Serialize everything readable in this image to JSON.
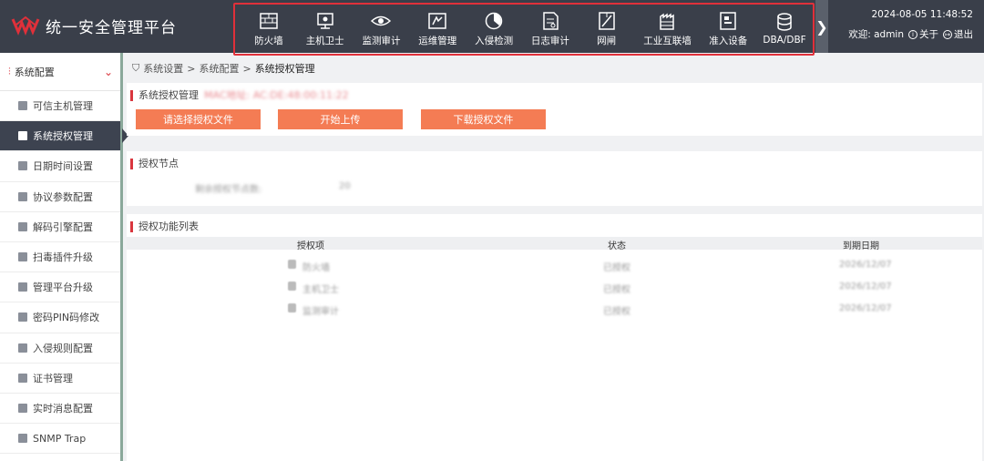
{
  "app": {
    "title": "统一安全管理平台"
  },
  "nav": {
    "items": [
      {
        "label": "防火墙",
        "icon": "firewall-icon"
      },
      {
        "label": "主机卫士",
        "icon": "host-guard-icon"
      },
      {
        "label": "监测审计",
        "icon": "eye-icon"
      },
      {
        "label": "运维管理",
        "icon": "ops-icon"
      },
      {
        "label": "入侵检测",
        "icon": "intrusion-icon"
      },
      {
        "label": "日志审计",
        "icon": "log-icon"
      },
      {
        "label": "网闸",
        "icon": "gateway-icon"
      },
      {
        "label": "工业互联墙",
        "icon": "industrial-icon"
      },
      {
        "label": "准入设备",
        "icon": "access-icon"
      },
      {
        "label": "DBA/DBF",
        "icon": "database-icon"
      }
    ],
    "more": "❯"
  },
  "header": {
    "datetime": "2024-08-05 11:48:52",
    "welcome": "欢迎: admin",
    "about": "关于",
    "logout": "退出"
  },
  "sidebar": {
    "group": "系统配置",
    "items": [
      {
        "label": "可信主机管理"
      },
      {
        "label": "系统授权管理",
        "active": true
      },
      {
        "label": "日期时间设置"
      },
      {
        "label": "协议参数配置"
      },
      {
        "label": "解码引擎配置"
      },
      {
        "label": "扫毒插件升级"
      },
      {
        "label": "管理平台升级"
      },
      {
        "label": "密码PIN码修改"
      },
      {
        "label": "入侵规则配置"
      },
      {
        "label": "证书管理"
      },
      {
        "label": "实时消息配置"
      },
      {
        "label": "SNMP Trap"
      }
    ]
  },
  "breadcrumb": {
    "a": "系统设置",
    "sep": ">",
    "b": "系统配置",
    "c": "系统授权管理"
  },
  "license": {
    "title": "系统授权管理",
    "note": "MAC地址: AC:DE:48:00:11:22",
    "btn_select": "请选择授权文件",
    "btn_upload": "开始上传",
    "btn_download": "下载授权文件"
  },
  "node": {
    "title": "授权节点",
    "label": "剩余授权节点数:",
    "value": "20"
  },
  "features": {
    "title": "授权功能列表",
    "columns": [
      "授权项",
      "状态",
      "到期日期"
    ],
    "rows": [
      [
        "防火墙",
        "已授权",
        "2026/12/07"
      ],
      [
        "主机卫士",
        "已授权",
        "2026/12/07"
      ],
      [
        "监测审计",
        "已授权",
        "2026/12/07"
      ]
    ]
  },
  "colors": {
    "accent": "#d9363e",
    "button": "#f47c54",
    "topbar": "#3a3f4a"
  }
}
